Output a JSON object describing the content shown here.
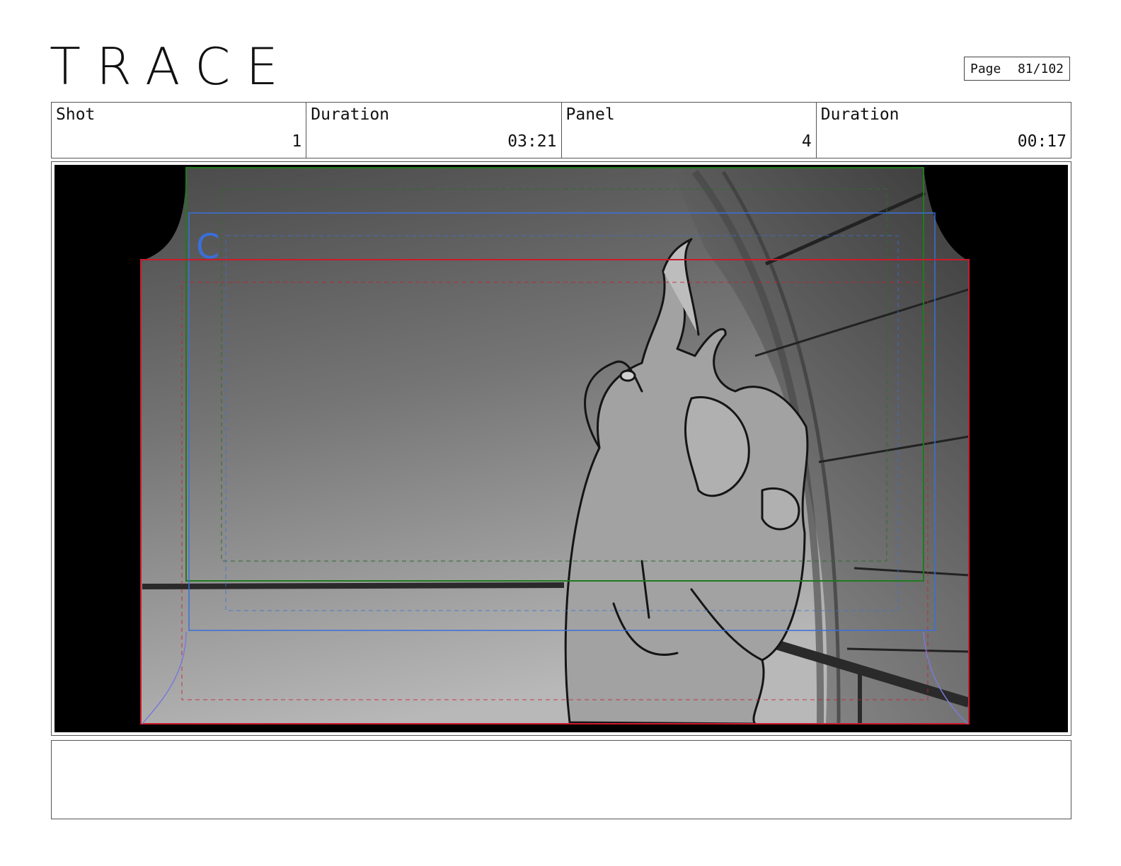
{
  "header": {
    "logo": "TRACE",
    "page_label": "Page",
    "page_value": "81/102"
  },
  "info": {
    "shot_label": "Shot",
    "shot_value": "1",
    "shot_duration_label": "Duration",
    "shot_duration_value": "03:21",
    "panel_label": "Panel",
    "panel_value": "4",
    "panel_duration_label": "Duration",
    "panel_duration_value": "00:17"
  },
  "frame": {
    "camera_marker": "C",
    "colors": {
      "red_frame": "#cc1a2a",
      "green_frame": "#1f7a1f",
      "blue_frame": "#3a6fd8",
      "sketch_gray": "#6e6e6e"
    }
  },
  "notes": {
    "text": ""
  }
}
